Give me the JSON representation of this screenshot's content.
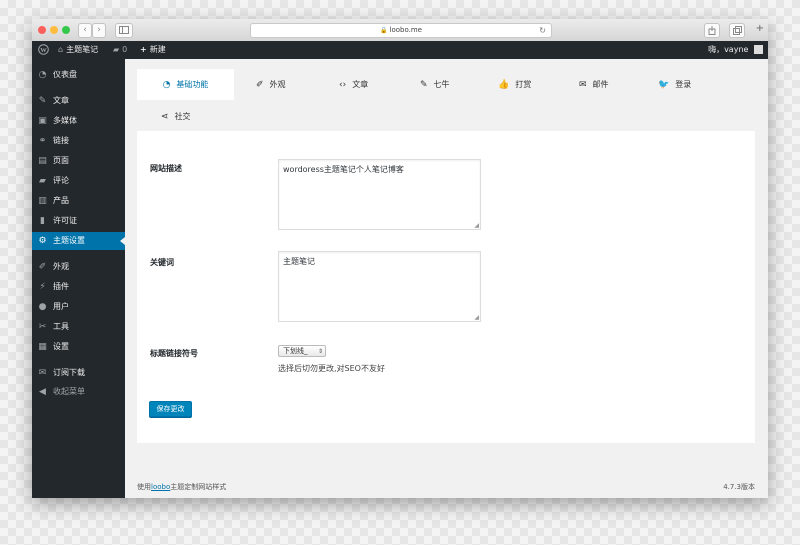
{
  "browser": {
    "url": "loobo.me",
    "back_glyph": "‹",
    "forward_glyph": "›"
  },
  "admin_bar": {
    "site_name": "主题笔记",
    "comments_count": "0",
    "new_label": "新建",
    "greeting": "嗨，vayne"
  },
  "sidebar": {
    "items": [
      {
        "label": "仪表盘",
        "icon": "dashboard-icon",
        "glyph": "◔"
      },
      {
        "label": "文章",
        "icon": "pin-icon",
        "glyph": "✎"
      },
      {
        "label": "多媒体",
        "icon": "media-icon",
        "glyph": "▣"
      },
      {
        "label": "链接",
        "icon": "link-icon",
        "glyph": "⚭"
      },
      {
        "label": "页面",
        "icon": "page-icon",
        "glyph": "▤"
      },
      {
        "label": "评论",
        "icon": "comment-icon",
        "glyph": "▰"
      },
      {
        "label": "产品",
        "icon": "product-icon",
        "glyph": "▥"
      },
      {
        "label": "许可证",
        "icon": "lock-icon",
        "glyph": "▮"
      },
      {
        "label": "主题设置",
        "icon": "gear-icon",
        "glyph": "⚙"
      },
      {
        "label": "外观",
        "icon": "brush-icon",
        "glyph": "✐"
      },
      {
        "label": "插件",
        "icon": "plugin-icon",
        "glyph": "⚡"
      },
      {
        "label": "用户",
        "icon": "user-icon",
        "glyph": "●"
      },
      {
        "label": "工具",
        "icon": "wrench-icon",
        "glyph": "✂"
      },
      {
        "label": "设置",
        "icon": "settings-icon",
        "glyph": "▦"
      },
      {
        "label": "订阅下载",
        "icon": "mail-icon",
        "glyph": "✉"
      },
      {
        "label": "收起菜单",
        "icon": "collapse-icon",
        "glyph": "◀"
      }
    ]
  },
  "tabs": [
    {
      "label": "基础功能",
      "icon": "dashboard-icon",
      "glyph": "◔"
    },
    {
      "label": "外观",
      "icon": "brush-icon",
      "glyph": "✐"
    },
    {
      "label": "文章",
      "icon": "code-icon",
      "glyph": "‹›"
    },
    {
      "label": "七牛",
      "icon": "upload-icon",
      "glyph": "✎"
    },
    {
      "label": "打赏",
      "icon": "thumbs-up-icon",
      "glyph": "👍"
    },
    {
      "label": "邮件",
      "icon": "envelope-icon",
      "glyph": "✉"
    },
    {
      "label": "登录",
      "icon": "twitter-icon",
      "glyph": "🐦"
    },
    {
      "label": "社交",
      "icon": "share-icon",
      "glyph": "⋖"
    }
  ],
  "form": {
    "site_description": {
      "label": "网站描述",
      "value": "wordoress主题笔记个人笔记博客"
    },
    "keywords": {
      "label": "关键词",
      "value": "主题笔记"
    },
    "title_separator": {
      "label": "标题链接符号",
      "selected": "下划线_",
      "hint": "选择后切勿更改,对SEO不友好"
    },
    "save_label": "保存更改"
  },
  "footer": {
    "prefix": "使用",
    "link": "loobo",
    "suffix": "主题定制网站样式",
    "version": "4.7.3版本"
  },
  "colors": {
    "admin_dark": "#23282d",
    "accent": "#0073aa",
    "button": "#0085ba"
  }
}
